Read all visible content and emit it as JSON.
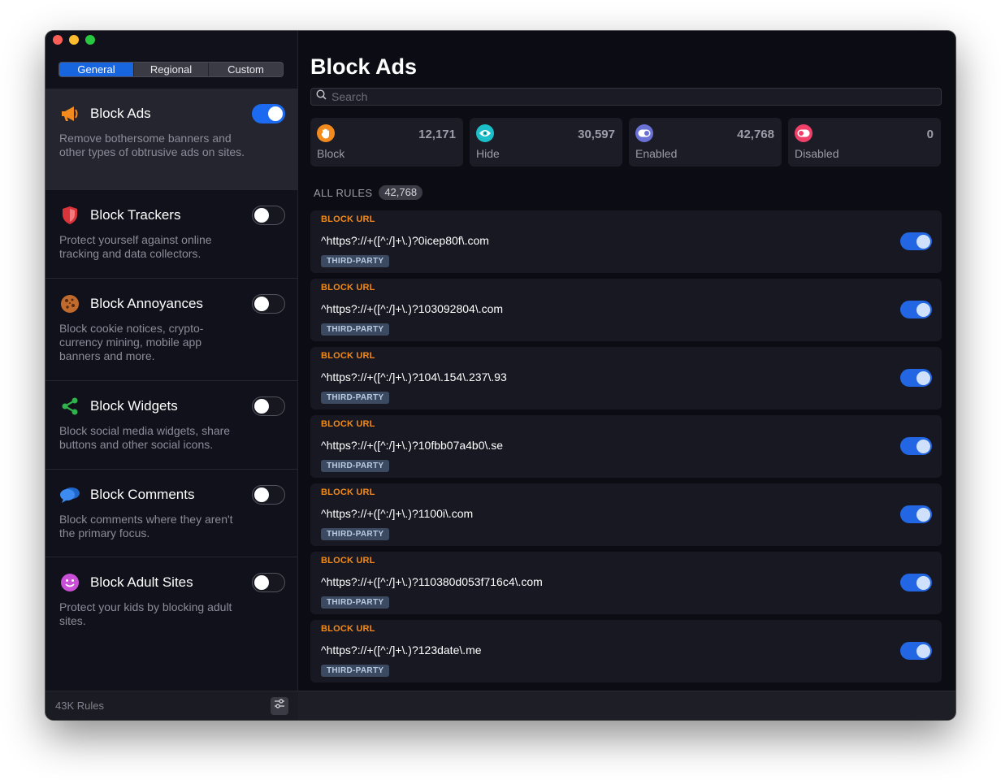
{
  "sidebar": {
    "tabs": [
      {
        "label": "General",
        "active": true
      },
      {
        "label": "Regional",
        "active": false
      },
      {
        "label": "Custom",
        "active": false
      }
    ],
    "categories": [
      {
        "icon": "megaphone-icon",
        "title": "Block Ads",
        "description": "Remove bothersome banners and other types of obtrusive ads on sites.",
        "enabled": true,
        "selected": true
      },
      {
        "icon": "shield-icon",
        "title": "Block Trackers",
        "description": "Protect yourself against online tracking and data collectors.",
        "enabled": false,
        "selected": false
      },
      {
        "icon": "cookie-icon",
        "title": "Block Annoyances",
        "description": "Block cookie notices, crypto-currency mining, mobile app banners and more.",
        "enabled": false,
        "selected": false
      },
      {
        "icon": "share-icon",
        "title": "Block Widgets",
        "description": "Block social media widgets, share buttons and other social icons.",
        "enabled": false,
        "selected": false
      },
      {
        "icon": "speech-bubbles-icon",
        "title": "Block Comments",
        "description": "Block comments where they aren't the primary focus.",
        "enabled": false,
        "selected": false
      },
      {
        "icon": "smiley-icon",
        "title": "Block Adult Sites",
        "description": "Protect your kids by blocking adult sites.",
        "enabled": false,
        "selected": false
      }
    ],
    "footer": {
      "rules_count": "43K Rules"
    }
  },
  "main": {
    "title": "Block Ads",
    "search": {
      "placeholder": "Search",
      "value": ""
    },
    "stats": [
      {
        "icon": "hand-icon",
        "label": "Block",
        "value": "12,171",
        "color": "#f28a1e"
      },
      {
        "icon": "eye-icon",
        "label": "Hide",
        "value": "30,597",
        "color": "#1cbfc9"
      },
      {
        "icon": "toggle-on-icon",
        "label": "Enabled",
        "value": "42,768",
        "color": "#6a72d6"
      },
      {
        "icon": "toggle-off-icon",
        "label": "Disabled",
        "value": "0",
        "color": "#f0406a"
      }
    ],
    "rules_header": {
      "label": "ALL RULES",
      "count": "42,768"
    },
    "rules": [
      {
        "type": "BLOCK URL",
        "pattern": "^https?://+([^:/]+\\.)?0icep80f\\.com",
        "tag": "THIRD-PARTY",
        "enabled": true
      },
      {
        "type": "BLOCK URL",
        "pattern": "^https?://+([^:/]+\\.)?103092804\\.com",
        "tag": "THIRD-PARTY",
        "enabled": true
      },
      {
        "type": "BLOCK URL",
        "pattern": "^https?://+([^:/]+\\.)?104\\.154\\.237\\.93",
        "tag": "THIRD-PARTY",
        "enabled": true
      },
      {
        "type": "BLOCK URL",
        "pattern": "^https?://+([^:/]+\\.)?10fbb07a4b0\\.se",
        "tag": "THIRD-PARTY",
        "enabled": true
      },
      {
        "type": "BLOCK URL",
        "pattern": "^https?://+([^:/]+\\.)?1100i\\.com",
        "tag": "THIRD-PARTY",
        "enabled": true
      },
      {
        "type": "BLOCK URL",
        "pattern": "^https?://+([^:/]+\\.)?110380d053f716c4\\.com",
        "tag": "THIRD-PARTY",
        "enabled": true
      },
      {
        "type": "BLOCK URL",
        "pattern": "^https?://+([^:/]+\\.)?123date\\.me",
        "tag": "THIRD-PARTY",
        "enabled": true
      }
    ]
  }
}
